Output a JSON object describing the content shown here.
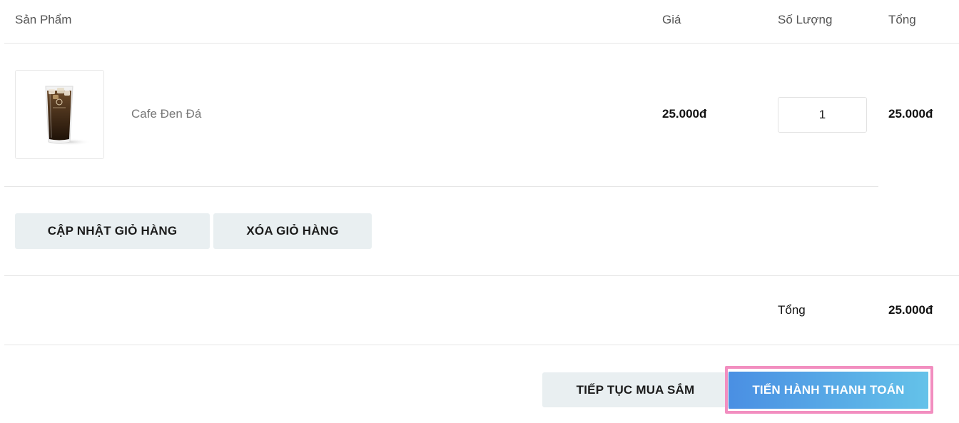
{
  "table": {
    "headers": {
      "product": "Sản Phẩm",
      "price": "Giá",
      "quantity": "Số Lượng",
      "total": "Tổng"
    },
    "rows": [
      {
        "name": "Cafe Đen Đá",
        "price": "25.000đ",
        "quantity": "1",
        "total": "25.000đ",
        "image_icon": "iced-coffee-image"
      }
    ]
  },
  "actions": {
    "update_cart": "CẬP NHẬT GIỎ HÀNG",
    "clear_cart": "XÓA GIỎ HÀNG"
  },
  "summary": {
    "label": "Tổng",
    "value": "25.000đ"
  },
  "footer": {
    "continue_shopping": "TIẾP TỤC MUA SẮM",
    "checkout": "TIẾN HÀNH THANH TOÁN"
  },
  "colors": {
    "button_bg": "#e9eff1",
    "checkout_gradient_start": "#4a8fe3",
    "checkout_gradient_end": "#64c2e9",
    "highlight_border": "#f28ec0"
  }
}
